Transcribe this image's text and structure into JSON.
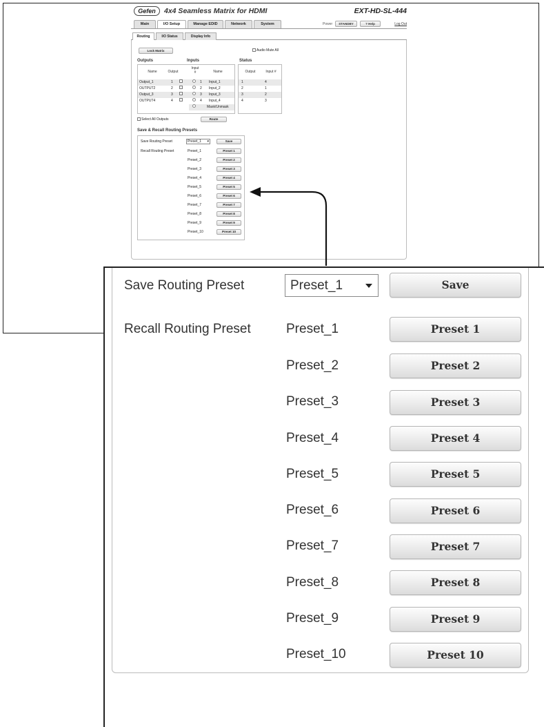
{
  "header": {
    "logo": "Gefen",
    "title": "4x4 Seamless Matrix for HDMI",
    "model": "EXT-HD-SL-444"
  },
  "main_tabs": [
    "Main",
    "I/O Setup",
    "Manage EDID",
    "Network",
    "System"
  ],
  "power": {
    "label": "Power",
    "standby_label": "STANDBY",
    "help_label": "? Help",
    "logout_label": "Log Out"
  },
  "sub_tabs": [
    "Routing",
    "I/O Status",
    "Display Info"
  ],
  "routing": {
    "lock_label": "Lock Matrix",
    "audio_mute_label": "Audio Mute All",
    "outputs_label": "Outputs",
    "inputs_label": "Inputs",
    "status_label": "Status",
    "outputs_headers": [
      "Name",
      "Output"
    ],
    "inputs_headers": [
      "Input #",
      "Name"
    ],
    "status_headers": [
      "Output",
      "Input #"
    ],
    "outputs": [
      {
        "name": "Output_1",
        "num": "1"
      },
      {
        "name": "OUTPUT2",
        "num": "2"
      },
      {
        "name": "Output_3",
        "num": "3"
      },
      {
        "name": "OUTPUT4",
        "num": "4"
      }
    ],
    "inputs": [
      {
        "num": "1",
        "name": "Input_1"
      },
      {
        "num": "2",
        "name": "Input_2"
      },
      {
        "num": "3",
        "name": "Input_3"
      },
      {
        "num": "4",
        "name": "Input_4"
      }
    ],
    "mask_label": "Mask/Unmask",
    "status": [
      {
        "output": "1",
        "input": "4"
      },
      {
        "output": "2",
        "input": "1"
      },
      {
        "output": "3",
        "input": "2"
      },
      {
        "output": "4",
        "input": "3"
      }
    ],
    "select_all_label": "Select All Outputs",
    "route_label": "Route"
  },
  "presets": {
    "section_label": "Save & Recall Routing Presets",
    "save_label": "Save Routing Preset",
    "save_selected": "Preset_1",
    "save_button": "Save",
    "recall_label": "Recall Routing Preset",
    "items": [
      {
        "name": "Preset_1",
        "button": "Preset 1"
      },
      {
        "name": "Preset_2",
        "button": "Preset 2"
      },
      {
        "name": "Preset_3",
        "button": "Preset 3"
      },
      {
        "name": "Preset_4",
        "button": "Preset 4"
      },
      {
        "name": "Preset_5",
        "button": "Preset 5"
      },
      {
        "name": "Preset_6",
        "button": "Preset 6"
      },
      {
        "name": "Preset_7",
        "button": "Preset 7"
      },
      {
        "name": "Preset_8",
        "button": "Preset 8"
      },
      {
        "name": "Preset_9",
        "button": "Preset 9"
      },
      {
        "name": "Preset_10",
        "button": "Preset 10"
      }
    ]
  }
}
